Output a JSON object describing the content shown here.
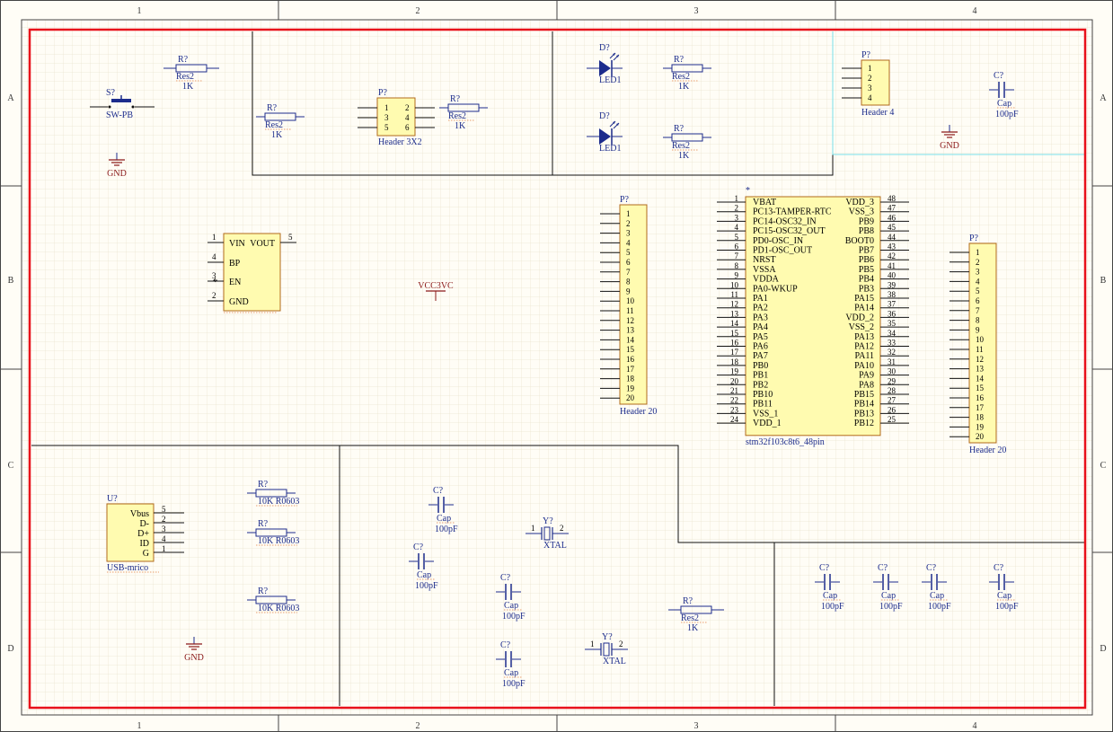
{
  "border": {
    "columns": [
      "1",
      "2",
      "3",
      "4"
    ],
    "rows": [
      "A",
      "B",
      "C",
      "D"
    ]
  },
  "colors": {
    "frame": "#e8101a",
    "wire": "#1c2c8c",
    "body_fill": "#fffbb0",
    "body_stroke": "#b26a1c",
    "power": "#8b1a1a",
    "grid": "#eae3cf",
    "region_highlight": "#7ae0ea"
  },
  "components": {
    "sw": {
      "designator": "S?",
      "value": "SW-PB"
    },
    "r_top": {
      "designator": "R?",
      "comment": "Res2",
      "value": "1K"
    },
    "gnd_a1": {
      "net": "GND"
    },
    "r_a2": {
      "designator": "R?",
      "comment": "Res2",
      "value": "1K"
    },
    "header_3x2": {
      "designator": "P?",
      "name": "Header 3X2",
      "pins_left": [
        "1",
        "3",
        "5"
      ],
      "pins_right": [
        "2",
        "4",
        "6"
      ]
    },
    "r_a2b": {
      "designator": "R?",
      "comment": "Res2",
      "value": "1K"
    },
    "led_1": {
      "designator": "D?",
      "name": "LED1"
    },
    "led_2": {
      "designator": "D?",
      "name": "LED1"
    },
    "r_led1": {
      "designator": "R?",
      "comment": "Res2",
      "value": "1K"
    },
    "r_led2": {
      "designator": "R?",
      "comment": "Res2",
      "value": "1K"
    },
    "header_4": {
      "designator": "P?",
      "name": "Header 4",
      "pins": [
        "1",
        "2",
        "3",
        "4"
      ]
    },
    "cap_a4": {
      "designator": "C?",
      "comment": "Cap",
      "value": "100pF"
    },
    "gnd_a4": {
      "net": "GND"
    },
    "regulator": {
      "pins": [
        {
          "num": "1",
          "label": "VIN"
        },
        {
          "num": "5",
          "label": "VOUT"
        },
        {
          "num": "4",
          "label": "BP"
        },
        {
          "num": "3",
          "label": "EN"
        },
        {
          "num": "2",
          "label": "GND"
        }
      ]
    },
    "vcc": {
      "net": "VCC3VC"
    },
    "header_20_left": {
      "designator": "P?",
      "name": "Header 20",
      "pins": [
        "1",
        "2",
        "3",
        "4",
        "5",
        "6",
        "7",
        "8",
        "9",
        "10",
        "11",
        "12",
        "13",
        "14",
        "15",
        "16",
        "17",
        "18",
        "19",
        "20"
      ]
    },
    "mcu": {
      "designator": "*",
      "name": "stm32f103c8t6_48pin",
      "left_pins": [
        {
          "num": "1",
          "name": "VBAT"
        },
        {
          "num": "2",
          "name": "PC13-TAMPER-RTC"
        },
        {
          "num": "3",
          "name": "PC14-OSC32_IN"
        },
        {
          "num": "4",
          "name": "PC15-OSC32_OUT"
        },
        {
          "num": "5",
          "name": "PD0-OSC_IN"
        },
        {
          "num": "6",
          "name": "PD1-OSC_OUT"
        },
        {
          "num": "7",
          "name": "NRST"
        },
        {
          "num": "8",
          "name": "VSSA"
        },
        {
          "num": "9",
          "name": "VDDA"
        },
        {
          "num": "10",
          "name": "PA0-WKUP"
        },
        {
          "num": "11",
          "name": "PA1"
        },
        {
          "num": "12",
          "name": "PA2"
        },
        {
          "num": "13",
          "name": "PA3"
        },
        {
          "num": "14",
          "name": "PA4"
        },
        {
          "num": "15",
          "name": "PA5"
        },
        {
          "num": "16",
          "name": "PA6"
        },
        {
          "num": "17",
          "name": "PA7"
        },
        {
          "num": "18",
          "name": "PB0"
        },
        {
          "num": "19",
          "name": "PB1"
        },
        {
          "num": "20",
          "name": "PB2"
        },
        {
          "num": "21",
          "name": "PB10"
        },
        {
          "num": "22",
          "name": "PB11"
        },
        {
          "num": "23",
          "name": "VSS_1"
        },
        {
          "num": "24",
          "name": "VDD_1"
        }
      ],
      "right_pins": [
        {
          "num": "48",
          "name": "VDD_3"
        },
        {
          "num": "47",
          "name": "VSS_3"
        },
        {
          "num": "46",
          "name": "PB9"
        },
        {
          "num": "45",
          "name": "PB8"
        },
        {
          "num": "44",
          "name": "BOOT0"
        },
        {
          "num": "43",
          "name": "PB7"
        },
        {
          "num": "42",
          "name": "PB6"
        },
        {
          "num": "41",
          "name": "PB5"
        },
        {
          "num": "40",
          "name": "PB4"
        },
        {
          "num": "39",
          "name": "PB3"
        },
        {
          "num": "38",
          "name": "PA15"
        },
        {
          "num": "37",
          "name": "PA14"
        },
        {
          "num": "36",
          "name": "VDD_2"
        },
        {
          "num": "35",
          "name": "VSS_2"
        },
        {
          "num": "34",
          "name": "PA13"
        },
        {
          "num": "33",
          "name": "PA12"
        },
        {
          "num": "32",
          "name": "PA11"
        },
        {
          "num": "31",
          "name": "PA10"
        },
        {
          "num": "30",
          "name": "PA9"
        },
        {
          "num": "29",
          "name": "PA8"
        },
        {
          "num": "28",
          "name": "PB15"
        },
        {
          "num": "27",
          "name": "PB14"
        },
        {
          "num": "26",
          "name": "PB13"
        },
        {
          "num": "25",
          "name": "PB12"
        }
      ]
    },
    "header_20_right": {
      "designator": "P?",
      "name": "Header 20",
      "pins": [
        "1",
        "2",
        "3",
        "4",
        "5",
        "6",
        "7",
        "8",
        "9",
        "10",
        "11",
        "12",
        "13",
        "14",
        "15",
        "16",
        "17",
        "18",
        "19",
        "20"
      ]
    },
    "usb": {
      "designator": "U?",
      "name": "USB-mrico",
      "pins": [
        {
          "num": "5",
          "name": "Vbus"
        },
        {
          "num": "2",
          "name": "D-"
        },
        {
          "num": "3",
          "name": "D+"
        },
        {
          "num": "4",
          "name": "ID"
        },
        {
          "num": "1",
          "name": "G"
        }
      ]
    },
    "r_usb1": {
      "designator": "R?",
      "value": "10K R0603"
    },
    "r_usb2": {
      "designator": "R?",
      "value": "10K R0603"
    },
    "r_usb3": {
      "designator": "R?",
      "value": "10K R0603"
    },
    "gnd_d1": {
      "net": "GND"
    },
    "cap_c2": {
      "designator": "C?",
      "comment": "Cap",
      "value": "100pF"
    },
    "cap_d2a": {
      "designator": "C?",
      "comment": "Cap",
      "value": "100pF"
    },
    "cap_d2b": {
      "designator": "C?",
      "comment": "Cap",
      "value": "100pF"
    },
    "cap_d2c": {
      "designator": "C?",
      "comment": "Cap",
      "value": "100pF"
    },
    "xtal_1": {
      "designator": "Y?",
      "name": "XTAL",
      "pin_left": "1",
      "pin_right": "2"
    },
    "xtal_2": {
      "designator": "Y?",
      "name": "XTAL",
      "pin_left": "1",
      "pin_right": "2"
    },
    "r_d3": {
      "designator": "R?",
      "comment": "Res2",
      "value": "1K"
    },
    "cap_d4a": {
      "designator": "C?",
      "comment": "Cap",
      "value": "100pF"
    },
    "cap_d4b": {
      "designator": "C?",
      "comment": "Cap",
      "value": "100pF"
    },
    "cap_d4c": {
      "designator": "C?",
      "comment": "Cap",
      "value": "100pF"
    },
    "cap_d4d": {
      "designator": "C?",
      "comment": "Cap",
      "value": "100pF"
    }
  }
}
